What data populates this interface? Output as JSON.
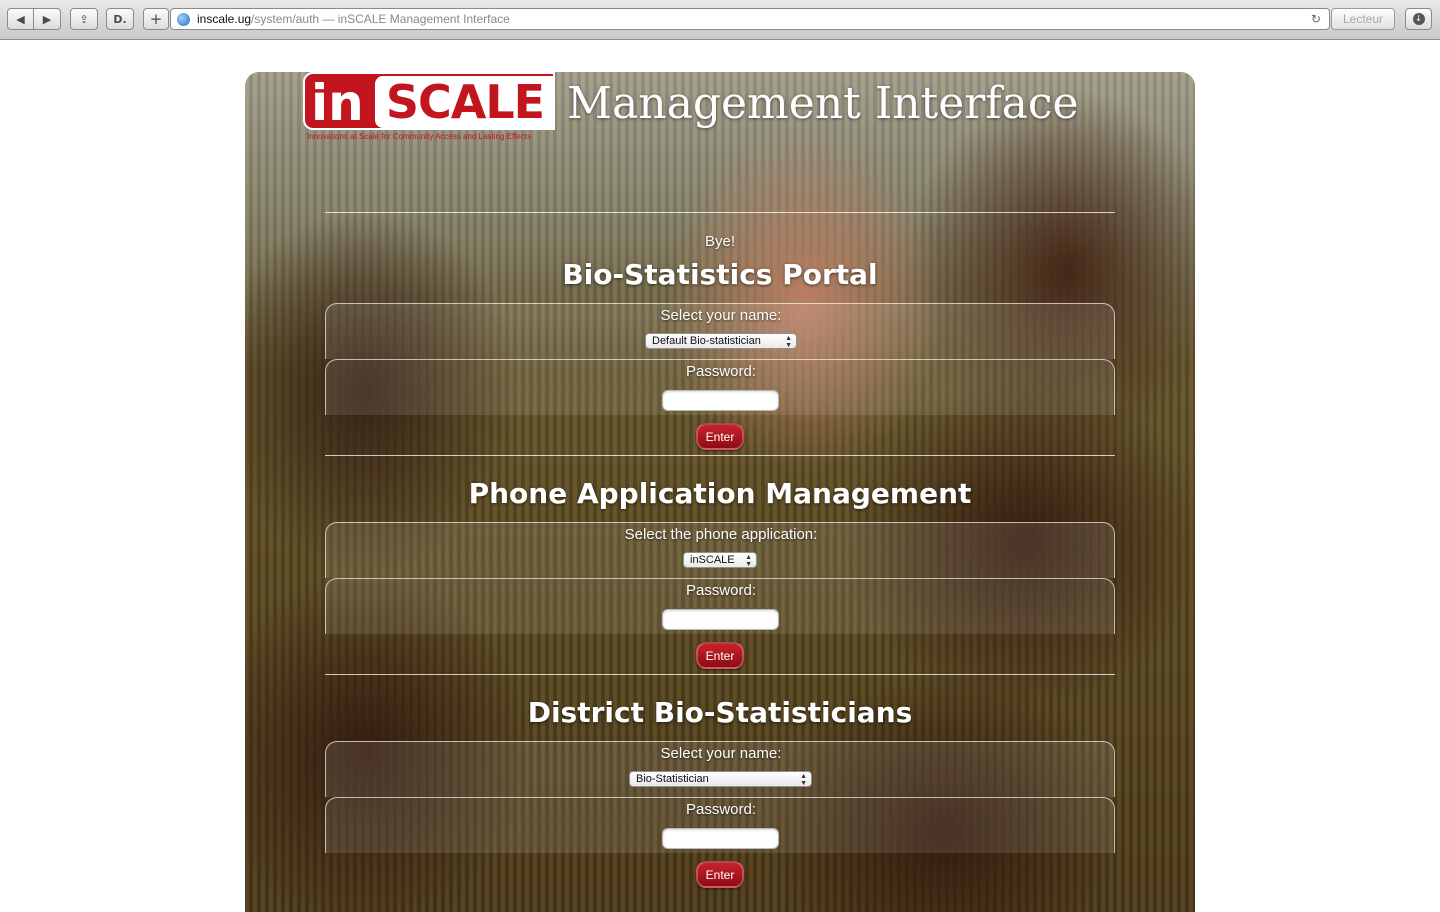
{
  "browser": {
    "url_host": "inscale.ug",
    "url_path": "/system/auth — inSCALE Management Interface",
    "reader_label": "Lecteur",
    "icons": [
      "back-icon",
      "forward-icon",
      "share-icon",
      "readability-icon",
      "new-tab-icon",
      "globe-icon",
      "reload-icon",
      "downloads-icon"
    ]
  },
  "header": {
    "logo_in": "in",
    "logo_scale": "SCALE",
    "logo_tagline": "Innovations at Scale for Community Access and Lasting Effects",
    "title": "Management Interface"
  },
  "message": "Bye!",
  "sections": [
    {
      "title": "Bio-Statistics Portal",
      "select_label": "Select your name:",
      "select_value": "Default Bio-statistician",
      "password_label": "Password:",
      "password_value": "",
      "enter_label": "Enter"
    },
    {
      "title": "Phone Application Management",
      "select_label": "Select the phone application:",
      "select_value": "inSCALE",
      "password_label": "Password:",
      "password_value": "",
      "enter_label": "Enter"
    },
    {
      "title": "District Bio-Statisticians",
      "select_label": "Select your name:",
      "select_value": "Bio-Statistician",
      "password_label": "Password:",
      "password_value": "",
      "enter_label": "Enter"
    }
  ],
  "colors": {
    "brand_red": "#c2151e",
    "button_red": "#a3121b",
    "text_white": "#ffffff"
  }
}
